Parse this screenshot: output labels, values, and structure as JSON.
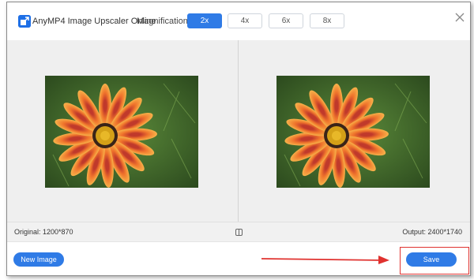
{
  "app": {
    "title": "AnyMP4 Image Upscaler Online",
    "logo": "logo-icon"
  },
  "magnification": {
    "label": "Magnification:",
    "options": [
      "2x",
      "4x",
      "6x",
      "8x"
    ],
    "selected": "2x"
  },
  "close": {
    "icon": "close-icon"
  },
  "info": {
    "original": "Original: 1200*870",
    "output": "Output: 2400*1740",
    "compare_icon": "compare-icon"
  },
  "footer": {
    "new_image_label": "New Image",
    "save_label": "Save"
  },
  "colors": {
    "accent": "#2f7be6",
    "annotation": "#e0322f"
  }
}
